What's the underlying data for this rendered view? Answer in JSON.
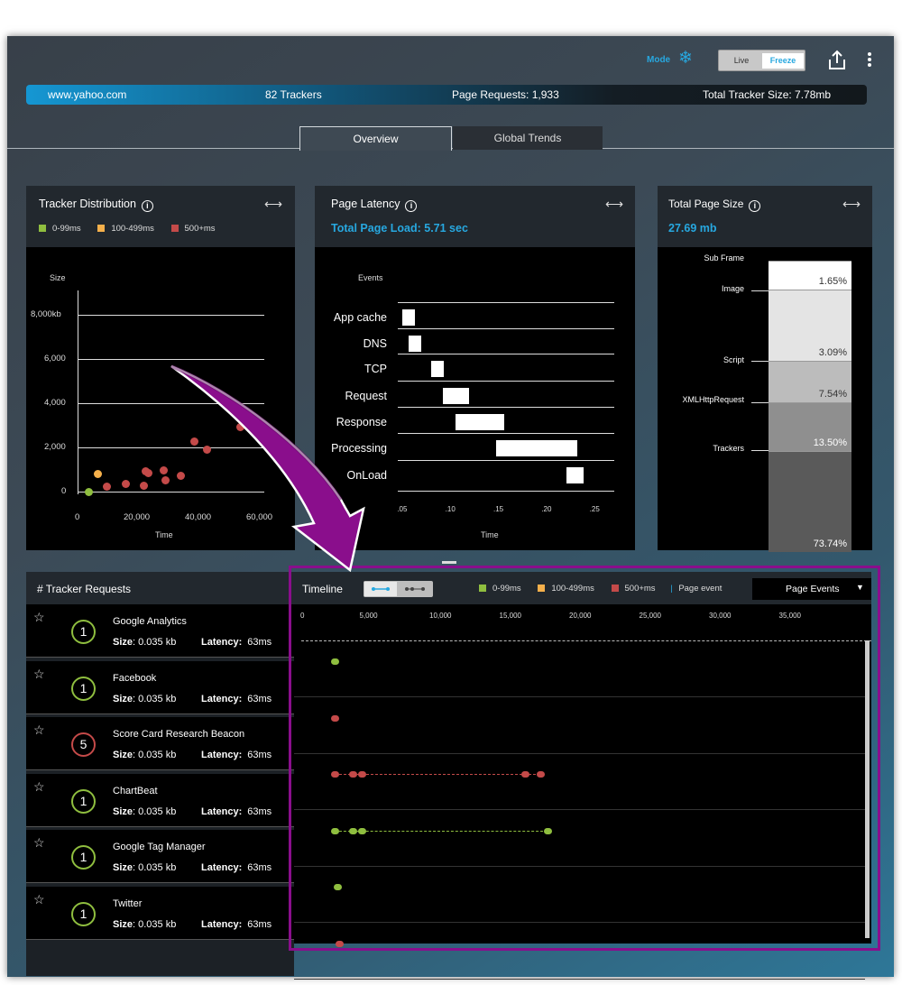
{
  "header": {
    "mode_label": "Mode",
    "mode_icon": "snowflake-icon",
    "toggle": {
      "live": "Live",
      "freeze": "Freeze",
      "selected": "Freeze"
    },
    "share_icon": "share-icon",
    "menu_icon": "more-vertical-icon"
  },
  "infobar": {
    "site": "www.yahoo.com",
    "trackers": "82 Trackers",
    "page_requests": "Page Requests: 1,933",
    "tracker_size": "Total Tracker Size: 7.78mb"
  },
  "tabs": [
    {
      "label": "Overview",
      "active": true
    },
    {
      "label": "Global Trends",
      "active": false
    }
  ],
  "colors": {
    "green": "#8fbe3f",
    "orange": "#f5b04b",
    "red": "#c44a49",
    "accent": "#27a8e0",
    "highlight": "#8a0e8c"
  },
  "tracker_distribution": {
    "title": "Tracker Distribution",
    "legend": [
      "0-99ms",
      "100-499ms",
      "500+ms"
    ],
    "ylabel": "Size",
    "yticks": [
      "8,000kb",
      "6,000",
      "4,000",
      "2,000",
      "0"
    ],
    "xticks": [
      "0",
      "20,000",
      "40,000",
      "60,000"
    ],
    "xlabel": "Time"
  },
  "page_latency": {
    "title": "Page Latency",
    "subtitle": "Total Page Load: 5.71 sec",
    "events_label": "Events",
    "events": [
      "App cache",
      "DNS",
      "TCP",
      "Request",
      "Response",
      "Processing",
      "OnLoad"
    ],
    "xticks": [
      ".05",
      ".10",
      ".15",
      ".20",
      ".25"
    ],
    "xlabel": "Time"
  },
  "total_page_size": {
    "title": "Total Page Size",
    "subtitle": "27.69 mb",
    "labels": [
      "Sub Frame",
      "Image",
      "Script",
      "XMLHttpRequest",
      "Trackers"
    ],
    "percents": [
      "1.65%",
      "3.09%",
      "7.54%",
      "13.50%",
      "73.74%"
    ]
  },
  "tracker_requests": {
    "title": "# Tracker Requests",
    "size_label": "Size",
    "latency_label": "Latency:",
    "rows": [
      {
        "name": "Google Analytics",
        "count": "1",
        "size": ": 0.035 kb",
        "latency": "63ms",
        "color": "green"
      },
      {
        "name": "Facebook",
        "count": "1",
        "size": ": 0.035 kb",
        "latency": "63ms",
        "color": "red"
      },
      {
        "name": "Score Card Research Beacon",
        "count": "5",
        "size": ": 0.035 kb",
        "latency": "63ms",
        "color": "red"
      },
      {
        "name": "ChartBeat",
        "count": "1",
        "size": ": 0.035 kb",
        "latency": "63ms",
        "color": "green"
      },
      {
        "name": "Google Tag Manager",
        "count": "1",
        "size": ": 0.035 kb",
        "latency": "63ms",
        "color": "green"
      },
      {
        "name": "Twitter",
        "count": "1",
        "size": ": 0.035 kb",
        "latency": "63ms",
        "color": "red"
      }
    ]
  },
  "timeline": {
    "title": "Timeline",
    "legend": [
      "0-99ms",
      "100-499ms",
      "500+ms"
    ],
    "page_event_label": "Page event",
    "dropdown": "Page Events",
    "xticks": [
      "0",
      "5,000",
      "10,000",
      "15,000",
      "20,000",
      "25,000",
      "30,000",
      "35,000"
    ]
  },
  "chart_data": [
    {
      "type": "scatter",
      "title": "Tracker Distribution",
      "xlabel": "Time",
      "ylabel": "Size",
      "xlim": [
        0,
        60000
      ],
      "ylim": [
        0,
        8000
      ],
      "series": [
        {
          "name": "0-99ms",
          "x": [
            3500
          ],
          "y": [
            0
          ]
        },
        {
          "name": "100-499ms",
          "x": [
            6500
          ],
          "y": [
            800
          ]
        },
        {
          "name": "500+ms",
          "x": [
            9500,
            15500,
            21500,
            22000,
            23000,
            28000,
            28500,
            33500,
            38000,
            42000,
            53000
          ],
          "y": [
            250,
            350,
            300,
            950,
            850,
            1000,
            550,
            750,
            2300,
            1900,
            2950
          ]
        }
      ]
    },
    {
      "type": "bar",
      "title": "Page Latency",
      "xlabel": "Time",
      "categories": [
        "App cache",
        "DNS",
        "TCP",
        "Request",
        "Response",
        "Processing",
        "OnLoad"
      ],
      "start": [
        0.05,
        0.056,
        0.08,
        0.092,
        0.105,
        0.147,
        0.22
      ],
      "end": [
        0.063,
        0.069,
        0.093,
        0.119,
        0.156,
        0.232,
        0.238
      ],
      "xlim": [
        0.045,
        0.27
      ]
    },
    {
      "type": "bar",
      "title": "Total Page Size",
      "categories": [
        "Sub Frame",
        "Image",
        "Script",
        "XMLHttpRequest",
        "Trackers"
      ],
      "values": [
        1.65,
        3.09,
        7.54,
        13.5,
        73.74
      ]
    },
    {
      "type": "scatter",
      "title": "Timeline",
      "xlim": [
        0,
        38000
      ],
      "series": [
        {
          "name": "Google Analytics",
          "x": [
            2400
          ]
        },
        {
          "name": "Facebook",
          "x": [
            2400
          ]
        },
        {
          "name": "Score Card Research Beacon",
          "x": [
            2400,
            3700,
            4300,
            16000,
            17100
          ]
        },
        {
          "name": "ChartBeat",
          "x": [
            2400,
            3700,
            4300,
            17600
          ]
        },
        {
          "name": "Google Tag Manager",
          "x": [
            2600
          ]
        },
        {
          "name": "Twitter",
          "x": [
            2700
          ]
        }
      ]
    }
  ]
}
